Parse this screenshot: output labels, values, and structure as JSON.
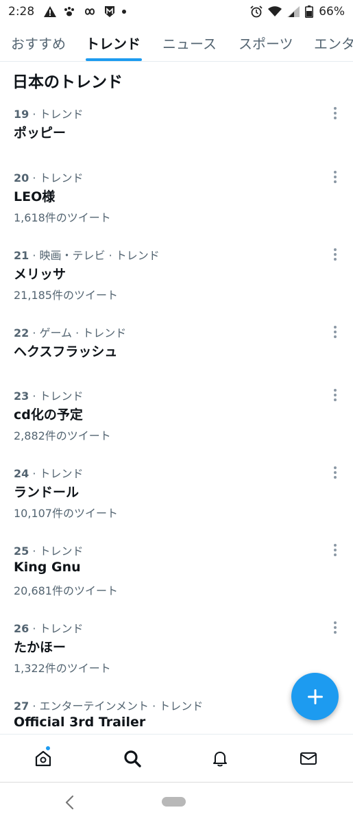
{
  "status_bar": {
    "time": "2:28",
    "battery": "66%",
    "icons": [
      "alert-icon",
      "paw-icon",
      "infinity-icon",
      "shield-m-icon",
      "dot-icon",
      "alarm-icon",
      "wifi-icon",
      "signal-icon",
      "battery-icon"
    ]
  },
  "tabs": [
    {
      "label": "おすすめ",
      "active": false
    },
    {
      "label": "トレンド",
      "active": true
    },
    {
      "label": "ニュース",
      "active": false
    },
    {
      "label": "スポーツ",
      "active": false
    },
    {
      "label": "エンタ",
      "active": false
    }
  ],
  "section": {
    "title": "日本のトレンド"
  },
  "trends": [
    {
      "rank": "19",
      "context": " · トレンド",
      "topic": "ポッピー",
      "count": ""
    },
    {
      "rank": "20",
      "context": " · トレンド",
      "topic": "LEO様",
      "count": "1,618件のツイート"
    },
    {
      "rank": "21",
      "context": " · 映画・テレビ · トレンド",
      "topic": "メリッサ",
      "count": "21,185件のツイート"
    },
    {
      "rank": "22",
      "context": " · ゲーム · トレンド",
      "topic": "ヘクスフラッシュ",
      "count": ""
    },
    {
      "rank": "23",
      "context": " · トレンド",
      "topic": "cd化の予定",
      "count": "2,882件のツイート"
    },
    {
      "rank": "24",
      "context": " · トレンド",
      "topic": "ランドール",
      "count": "10,107件のツイート"
    },
    {
      "rank": "25",
      "context": " · トレンド",
      "topic": "King Gnu",
      "count": "20,681件のツイート"
    },
    {
      "rank": "26",
      "context": " · トレンド",
      "topic": "たかほー",
      "count": "1,322件のツイート"
    },
    {
      "rank": "27",
      "context": " · エンターテインメント · トレンド",
      "topic": "Official 3rd Trailer",
      "count": ""
    }
  ],
  "fab": {
    "icon": "plus-icon"
  },
  "bottom_nav": [
    {
      "name": "home",
      "icon": "home-icon",
      "has_badge": true
    },
    {
      "name": "search",
      "icon": "search-icon",
      "active": true
    },
    {
      "name": "notifications",
      "icon": "bell-icon"
    },
    {
      "name": "messages",
      "icon": "mail-icon"
    }
  ],
  "colors": {
    "accent": "#1d9bf0",
    "text": "#0f1419",
    "secondary": "#536471"
  }
}
